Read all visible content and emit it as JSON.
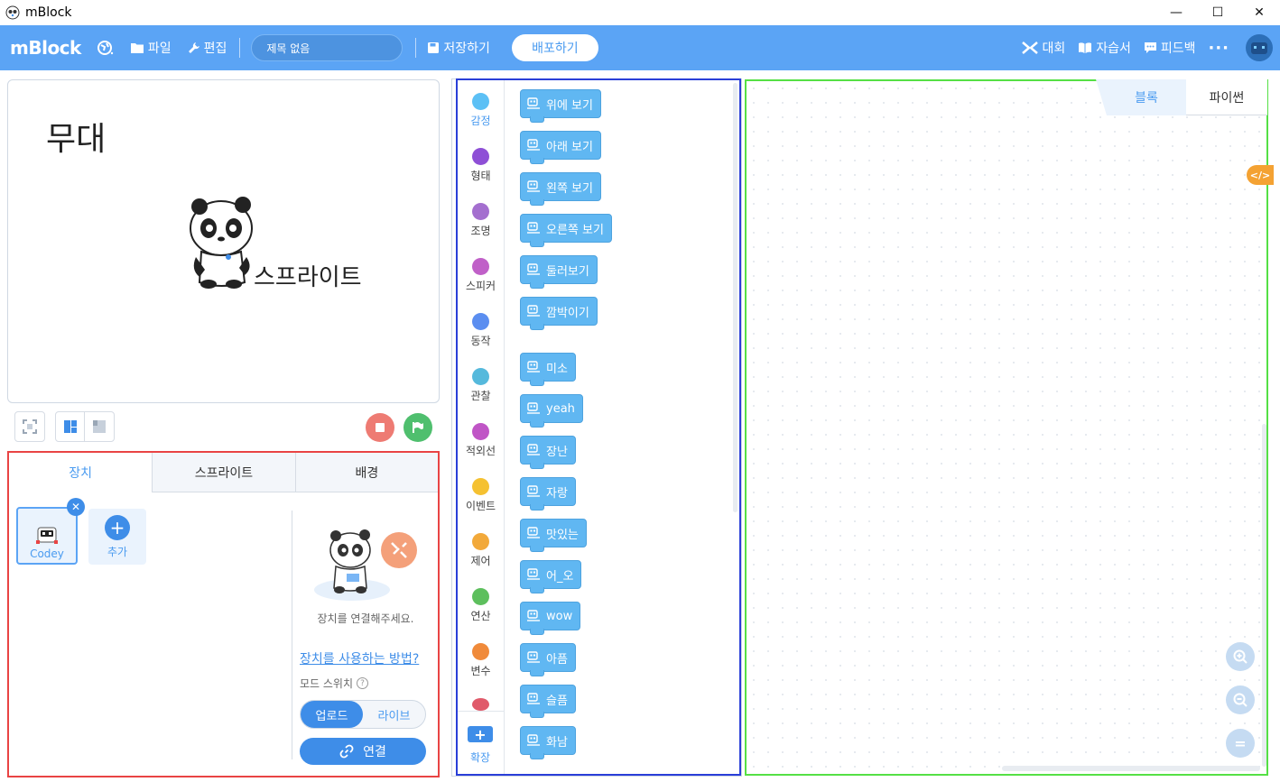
{
  "window": {
    "title": "mBlock",
    "minimize": "—",
    "maximize": "☐",
    "close": "✕"
  },
  "appbar": {
    "logo": "mBlock",
    "file": "파일",
    "edit": "편집",
    "project_title": "제목 없음",
    "save": "저장하기",
    "publish": "배포하기",
    "competition": "대회",
    "tutorial": "자습서",
    "feedback": "피드백",
    "more": "···"
  },
  "stage": {
    "title": "무대",
    "sprite_label": "스프라이트"
  },
  "device_panel": {
    "tabs": [
      "장치",
      "스프라이트",
      "배경"
    ],
    "device_name": "Codey",
    "add_label": "추가",
    "remove": "✕",
    "connect_hint": "장치를 연결해주세요.",
    "howto_link": "장치를 사용하는 방법?",
    "mode_label": "모드 스위치",
    "mode_help": "?",
    "mode_upload": "업로드",
    "mode_live": "라이브",
    "connect_button": "연결"
  },
  "categories": [
    {
      "label": "감정",
      "color": "#5cc0f5"
    },
    {
      "label": "형태",
      "color": "#8e4fd6"
    },
    {
      "label": "조명",
      "color": "#a46fcf"
    },
    {
      "label": "스피커",
      "color": "#c060c8"
    },
    {
      "label": "동작",
      "color": "#5b8ef0"
    },
    {
      "label": "관찰",
      "color": "#55b9dc"
    },
    {
      "label": "적외선",
      "color": "#c055c6"
    },
    {
      "label": "이벤트",
      "color": "#f5c131"
    },
    {
      "label": "제어",
      "color": "#f2a93a"
    },
    {
      "label": "연산",
      "color": "#5dbf5d"
    },
    {
      "label": "변수",
      "color": "#f08a3a"
    }
  ],
  "extension_label": "확장",
  "blocks": [
    "위에 보기",
    "아래 보기",
    "왼쪽 보기",
    "오른쪽 보기",
    "둘러보기",
    "깜박이기",
    "미소",
    "yeah",
    "장난",
    "자랑",
    "맛있는",
    "어_오",
    "wow",
    "아픔",
    "슬픔",
    "화남"
  ],
  "script_tabs": {
    "blocks": "블록",
    "python": "파이썬"
  },
  "code_toggle": "</>",
  "zoom": {
    "in": "+",
    "out": "−",
    "reset": "="
  },
  "colors": {
    "accent": "#5ba4f5",
    "block": "#60b7f2"
  }
}
